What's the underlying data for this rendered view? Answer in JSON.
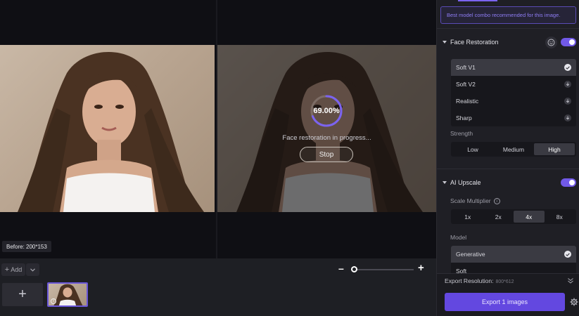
{
  "preview": {
    "before_tag": "Before: 200*153",
    "progress_value": 69.0,
    "progress_text": "69.00%",
    "progress_message": "Face restoration in progress...",
    "stop_label": "Stop"
  },
  "bottom_bar": {
    "add_label": "Add",
    "zoom_level_fraction": 0.0
  },
  "panel": {
    "tip": "Best model combo recommended for this image.",
    "face_restoration": {
      "title": "Face Restoration",
      "enabled": true,
      "models": [
        {
          "label": "Soft V1",
          "state": "selected"
        },
        {
          "label": "Soft V2",
          "state": "download"
        },
        {
          "label": "Realistic",
          "state": "download"
        },
        {
          "label": "Sharp",
          "state": "download"
        }
      ],
      "strength_label": "Strength",
      "strength_options": [
        "Low",
        "Medium",
        "High"
      ],
      "strength_selected": "High"
    },
    "ai_upscale": {
      "title": "AI Upscale",
      "enabled": true,
      "scale_label": "Scale Multiplier",
      "scale_options": [
        "1x",
        "2x",
        "4x",
        "8x"
      ],
      "scale_selected": "4x",
      "model_label": "Model",
      "models": [
        {
          "label": "Generative",
          "state": "selected"
        },
        {
          "label": "Soft",
          "state": "none"
        }
      ]
    },
    "export": {
      "resolution_label": "Export Resolution:",
      "resolution_value": "800*612",
      "button_label": "Export 1 images"
    }
  },
  "colors": {
    "accent": "#6348e0",
    "accent_light": "#7159e8",
    "tip_text": "#8f7df5"
  }
}
